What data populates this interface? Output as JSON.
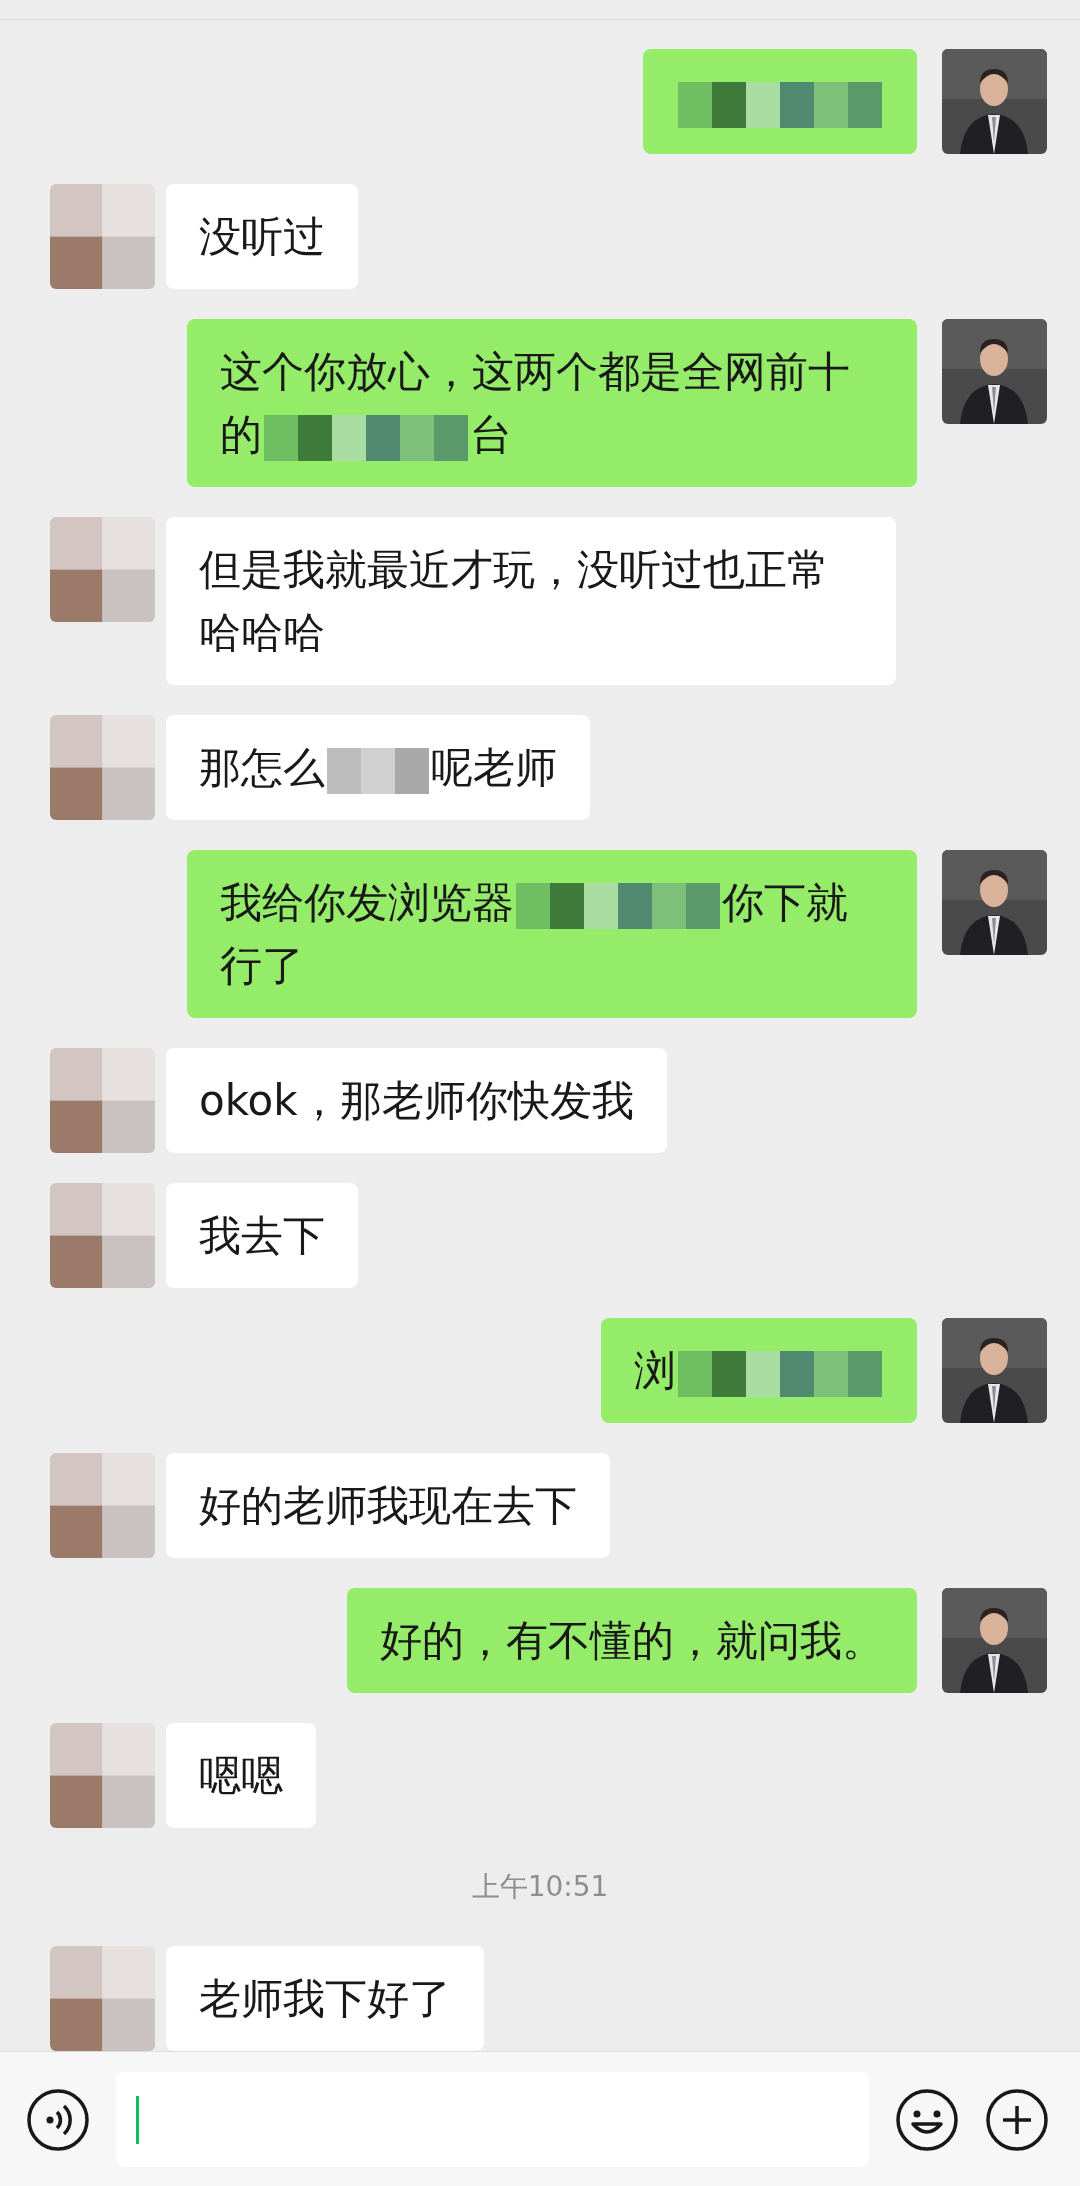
{
  "messages": [
    {
      "kind": "sent",
      "parts": [
        {
          "kind": "redacted"
        }
      ]
    },
    {
      "kind": "received",
      "parts": [
        {
          "kind": "text",
          "text": "没听过"
        }
      ]
    },
    {
      "kind": "sent",
      "parts": [
        {
          "kind": "text",
          "text": "这个你放心，这两个都是全网前十的"
        },
        {
          "kind": "redacted"
        },
        {
          "kind": "text",
          "text": "台"
        }
      ]
    },
    {
      "kind": "received",
      "parts": [
        {
          "kind": "text",
          "text": "但是我就最近才玩，没听过也正常哈哈哈"
        }
      ]
    },
    {
      "kind": "received",
      "parts": [
        {
          "kind": "text",
          "text": "那怎么"
        },
        {
          "kind": "redacted"
        },
        {
          "kind": "text",
          "text": "呢老师"
        }
      ]
    },
    {
      "kind": "sent",
      "parts": [
        {
          "kind": "text",
          "text": "我给你发浏览器"
        },
        {
          "kind": "redacted"
        },
        {
          "kind": "text",
          "text": "你下就行了"
        }
      ]
    },
    {
      "kind": "received",
      "parts": [
        {
          "kind": "text",
          "text": "okok，那老师你快发我"
        }
      ]
    },
    {
      "kind": "received",
      "parts": [
        {
          "kind": "text",
          "text": "我去下"
        }
      ]
    },
    {
      "kind": "sent",
      "parts": [
        {
          "kind": "text",
          "text": "浏"
        },
        {
          "kind": "redacted"
        }
      ]
    },
    {
      "kind": "received",
      "parts": [
        {
          "kind": "text",
          "text": "好的老师我现在去下"
        }
      ]
    },
    {
      "kind": "sent",
      "parts": [
        {
          "kind": "text",
          "text": "好的，有不懂的，就问我。"
        }
      ]
    },
    {
      "kind": "received",
      "parts": [
        {
          "kind": "text",
          "text": "嗯嗯"
        }
      ]
    },
    {
      "kind": "time",
      "text": "上午10:51"
    },
    {
      "kind": "received",
      "parts": [
        {
          "kind": "text",
          "text": "老师我下好了"
        }
      ]
    }
  ]
}
